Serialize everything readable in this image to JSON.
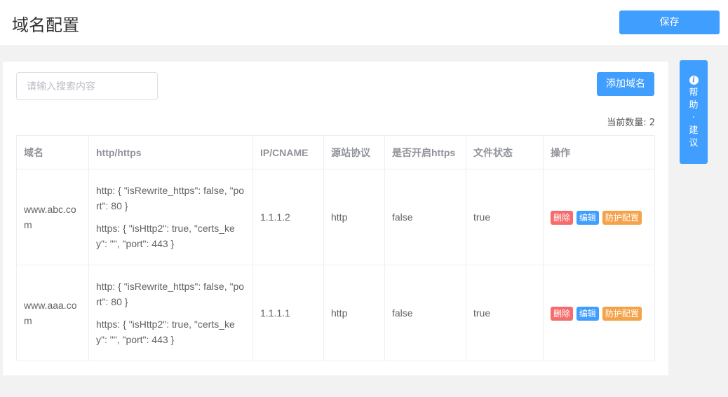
{
  "header": {
    "title": "域名配置",
    "save_label": "保存"
  },
  "toolbar": {
    "search_placeholder": "请输入搜索内容",
    "add_label": "添加域名",
    "count_text": "当前数量: 2"
  },
  "table": {
    "columns": [
      "域名",
      "http/https",
      "IP/CNAME",
      "源站协议",
      "是否开启https",
      "文件状态",
      "操作"
    ],
    "rows": [
      {
        "domain": "www.abc.com",
        "http": "http: { \"isRewrite_https\": false, \"port\": 80 }",
        "https": "https: { \"isHttp2\": true, \"certs_key\": \"\", \"port\": 443 }",
        "ip": "1.1.1.2",
        "protocol": "http",
        "https_enabled": "false",
        "file_status": "true",
        "actions": {
          "delete": "删除",
          "edit": "编辑",
          "protect": "防护配置"
        }
      },
      {
        "domain": "www.aaa.com",
        "http": "http: { \"isRewrite_https\": false, \"port\": 80 }",
        "https": "https: { \"isHttp2\": true, \"certs_key\": \"\", \"port\": 443 }",
        "ip": "1.1.1.1",
        "protocol": "http",
        "https_enabled": "false",
        "file_status": "true",
        "actions": {
          "delete": "删除",
          "edit": "编辑",
          "protect": "防护配置"
        }
      }
    ]
  },
  "help": {
    "icon": "info-icon",
    "label": "帮助·建议"
  },
  "colors": {
    "primary": "#409eff",
    "danger": "#f56c6c",
    "warning": "#f5a34b",
    "success": "#67c23a"
  }
}
